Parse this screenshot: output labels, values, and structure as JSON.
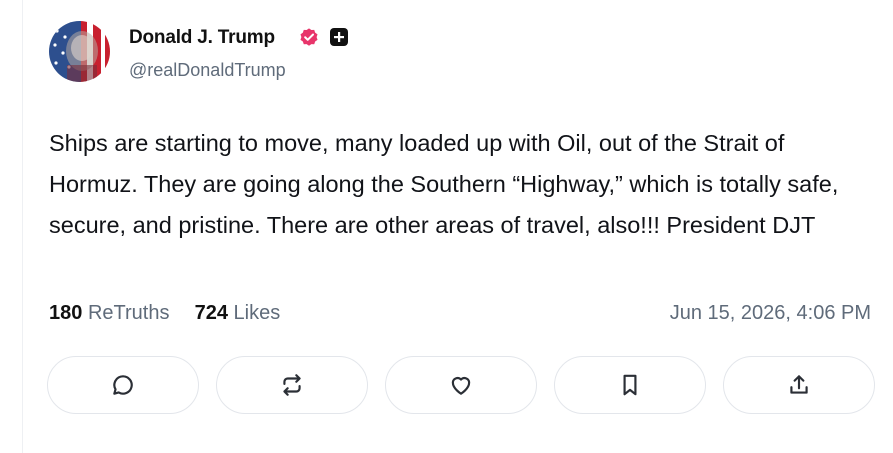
{
  "author": {
    "display_name": "Donald J. Trump",
    "handle": "@realDonaldTrump"
  },
  "post": {
    "text": "Ships are starting to move, many loaded up with Oil, out of the Strait of Hormuz. They are going along the Southern “Highway,” which is totally safe, secure, and pristine. There are other areas of travel, also!!!  President DJT"
  },
  "stats": {
    "retruths_count": "180",
    "retruths_label": "ReTruths",
    "likes_count": "724",
    "likes_label": "Likes"
  },
  "timestamp": "Jun 15, 2026, 4:06 PM",
  "icons": {
    "verified": "verified-badge-icon",
    "plus": "plus-square-icon",
    "reply": "comment-bubble-icon",
    "retruth": "repost-arrows-icon",
    "like": "heart-icon",
    "bookmark": "bookmark-icon",
    "share": "share-upload-icon"
  },
  "colors": {
    "verified_badge": "#e8356b",
    "muted_text": "#5f6b7a",
    "button_border": "#e3e6eb"
  }
}
